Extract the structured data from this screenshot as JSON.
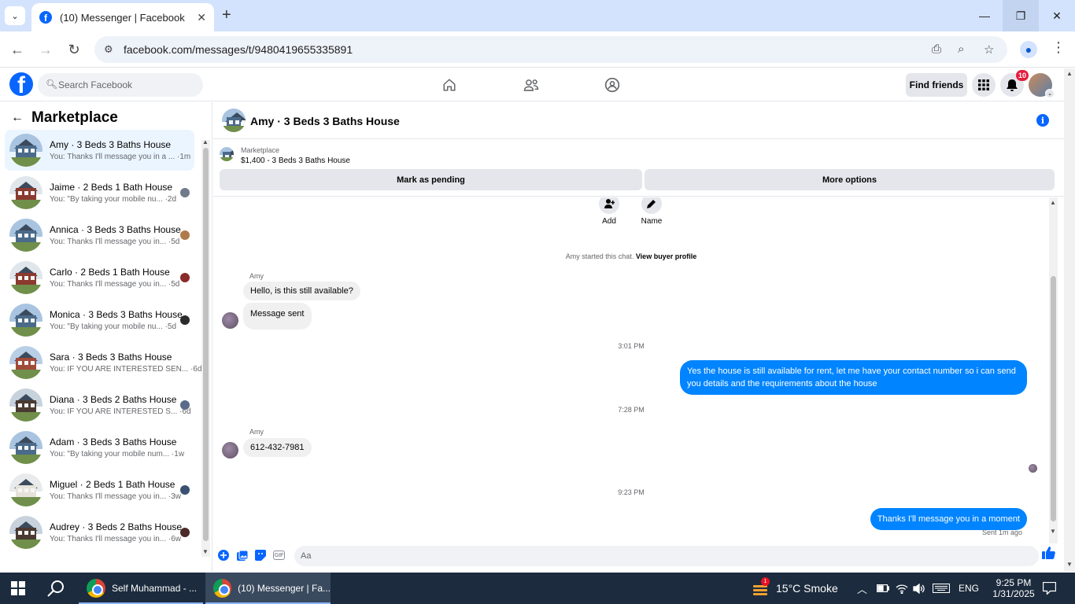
{
  "browser": {
    "tab_title": "(10) Messenger | Facebook",
    "url": "facebook.com/messages/t/9480419655335891"
  },
  "fb_header": {
    "search_placeholder": "Search Facebook",
    "find_friends": "Find friends",
    "notification_count": "10"
  },
  "sidebar": {
    "title": "Marketplace",
    "conversations": [
      {
        "name": "Amy · 3 Beds 3 Baths House",
        "snippet": "You: Thanks I'll message you in a ... ·1m",
        "sky": "#a8c4e0",
        "body": "#4a6a8a",
        "seen": ""
      },
      {
        "name": "Jaime · 2 Beds 1 Bath House",
        "snippet": "You: \"By taking your mobile nu... ·2d",
        "sky": "#dfe6ec",
        "body": "#8b3a2f",
        "seen": "#6f7b8a"
      },
      {
        "name": "Annica · 3 Beds 3 Baths House",
        "snippet": "You: Thanks I'll message you in... ·5d",
        "sky": "#a8c4e0",
        "body": "#4a6a8a",
        "seen": "#b07a4a"
      },
      {
        "name": "Carlo · 2 Beds 1 Bath House",
        "snippet": "You: Thanks I'll message you in... ·5d",
        "sky": "#dfe6ec",
        "body": "#8b3a2f",
        "seen": "#8a2a2a"
      },
      {
        "name": "Monica · 3 Beds 3 Baths House",
        "snippet": "You: \"By taking your mobile nu... ·5d",
        "sky": "#a8c4e0",
        "body": "#4a6a8a",
        "seen": "#2b2b2b"
      },
      {
        "name": "Sara · 3 Beds 3 Baths House",
        "snippet": "You: IF YOU ARE INTERESTED SEN... ·6d",
        "sky": "#b8cfe6",
        "body": "#a04a3a",
        "seen": ""
      },
      {
        "name": "Diana · 3 Beds 2 Baths House",
        "snippet": "You: IF YOU ARE INTERESTED S... ·6d",
        "sky": "#c7d2dc",
        "body": "#4a3a32",
        "seen": "#5a6a8a"
      },
      {
        "name": "Adam · 3 Beds 3 Baths House",
        "snippet": "You: \"By taking your mobile num... ·1w",
        "sky": "#a8c4e0",
        "body": "#4a6a8a",
        "seen": ""
      },
      {
        "name": "Miguel · 2 Beds 1 Bath House",
        "snippet": "You: Thanks I'll message you in... ·3w",
        "sky": "#e8eaec",
        "body": "#e6e2da",
        "seen": "#3a5070"
      },
      {
        "name": "Audrey · 3 Beds 2 Baths House",
        "snippet": "You: Thanks I'll message you in... ·6w",
        "sky": "#c7d2dc",
        "body": "#4a3a32",
        "seen": "#4a2a2a"
      }
    ]
  },
  "chat": {
    "title": "Amy · 3 Beds 3 Baths House",
    "listing_source": "Marketplace",
    "listing_price": "$1,400 - 3 Beds 3 Baths House",
    "mark_pending": "Mark as pending",
    "more_options": "More options",
    "quick_add": "Add",
    "quick_name": "Name",
    "system_text": "Amy started this chat.",
    "system_link": "View buyer profile",
    "sender_1": "Amy",
    "msg_1": "Hello, is this still available?",
    "msg_2": "Message sent",
    "time_1": "3:01 PM",
    "msg_3": "Yes the house is still available for rent, let me have your contact number so i can send you details and the requirements about the house",
    "time_2": "7:28 PM",
    "sender_2": "Amy",
    "msg_4": "612-432-7981",
    "time_3": "9:23 PM",
    "msg_5": "Thanks I'll message you in a moment",
    "sent_status": "Sent 1m ago",
    "composer_placeholder": "Aa"
  },
  "taskbar": {
    "task_1": "Self Muhammad - ...",
    "task_2": "(10) Messenger | Fa...",
    "weather": "15°C  Smoke",
    "weather_badge": "1",
    "lang": "ENG",
    "time": "9:25 PM",
    "date": "1/31/2025"
  }
}
